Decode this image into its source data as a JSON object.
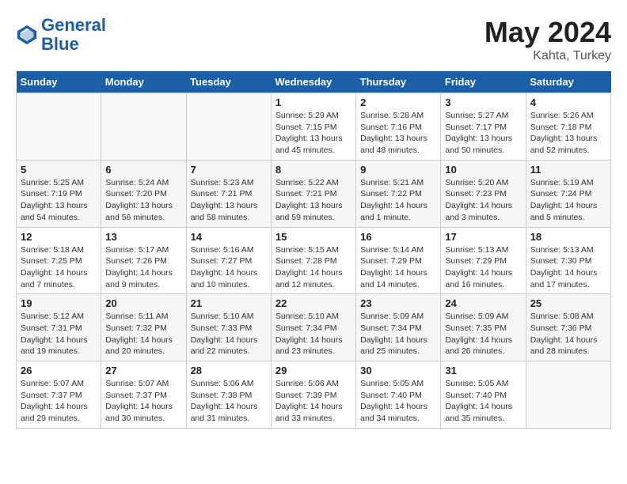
{
  "header": {
    "logo_line1": "General",
    "logo_line2": "Blue",
    "month": "May 2024",
    "location": "Kahta, Turkey"
  },
  "days_of_week": [
    "Sunday",
    "Monday",
    "Tuesday",
    "Wednesday",
    "Thursday",
    "Friday",
    "Saturday"
  ],
  "weeks": [
    [
      {
        "num": "",
        "info": ""
      },
      {
        "num": "",
        "info": ""
      },
      {
        "num": "",
        "info": ""
      },
      {
        "num": "1",
        "info": "Sunrise: 5:29 AM\nSunset: 7:15 PM\nDaylight: 13 hours\nand 45 minutes."
      },
      {
        "num": "2",
        "info": "Sunrise: 5:28 AM\nSunset: 7:16 PM\nDaylight: 13 hours\nand 48 minutes."
      },
      {
        "num": "3",
        "info": "Sunrise: 5:27 AM\nSunset: 7:17 PM\nDaylight: 13 hours\nand 50 minutes."
      },
      {
        "num": "4",
        "info": "Sunrise: 5:26 AM\nSunset: 7:18 PM\nDaylight: 13 hours\nand 52 minutes."
      }
    ],
    [
      {
        "num": "5",
        "info": "Sunrise: 5:25 AM\nSunset: 7:19 PM\nDaylight: 13 hours\nand 54 minutes."
      },
      {
        "num": "6",
        "info": "Sunrise: 5:24 AM\nSunset: 7:20 PM\nDaylight: 13 hours\nand 56 minutes."
      },
      {
        "num": "7",
        "info": "Sunrise: 5:23 AM\nSunset: 7:21 PM\nDaylight: 13 hours\nand 58 minutes."
      },
      {
        "num": "8",
        "info": "Sunrise: 5:22 AM\nSunset: 7:21 PM\nDaylight: 13 hours\nand 59 minutes."
      },
      {
        "num": "9",
        "info": "Sunrise: 5:21 AM\nSunset: 7:22 PM\nDaylight: 14 hours\nand 1 minute."
      },
      {
        "num": "10",
        "info": "Sunrise: 5:20 AM\nSunset: 7:23 PM\nDaylight: 14 hours\nand 3 minutes."
      },
      {
        "num": "11",
        "info": "Sunrise: 5:19 AM\nSunset: 7:24 PM\nDaylight: 14 hours\nand 5 minutes."
      }
    ],
    [
      {
        "num": "12",
        "info": "Sunrise: 5:18 AM\nSunset: 7:25 PM\nDaylight: 14 hours\nand 7 minutes."
      },
      {
        "num": "13",
        "info": "Sunrise: 5:17 AM\nSunset: 7:26 PM\nDaylight: 14 hours\nand 9 minutes."
      },
      {
        "num": "14",
        "info": "Sunrise: 5:16 AM\nSunset: 7:27 PM\nDaylight: 14 hours\nand 10 minutes."
      },
      {
        "num": "15",
        "info": "Sunrise: 5:15 AM\nSunset: 7:28 PM\nDaylight: 14 hours\nand 12 minutes."
      },
      {
        "num": "16",
        "info": "Sunrise: 5:14 AM\nSunset: 7:29 PM\nDaylight: 14 hours\nand 14 minutes."
      },
      {
        "num": "17",
        "info": "Sunrise: 5:13 AM\nSunset: 7:29 PM\nDaylight: 14 hours\nand 16 minutes."
      },
      {
        "num": "18",
        "info": "Sunrise: 5:13 AM\nSunset: 7:30 PM\nDaylight: 14 hours\nand 17 minutes."
      }
    ],
    [
      {
        "num": "19",
        "info": "Sunrise: 5:12 AM\nSunset: 7:31 PM\nDaylight: 14 hours\nand 19 minutes."
      },
      {
        "num": "20",
        "info": "Sunrise: 5:11 AM\nSunset: 7:32 PM\nDaylight: 14 hours\nand 20 minutes."
      },
      {
        "num": "21",
        "info": "Sunrise: 5:10 AM\nSunset: 7:33 PM\nDaylight: 14 hours\nand 22 minutes."
      },
      {
        "num": "22",
        "info": "Sunrise: 5:10 AM\nSunset: 7:34 PM\nDaylight: 14 hours\nand 23 minutes."
      },
      {
        "num": "23",
        "info": "Sunrise: 5:09 AM\nSunset: 7:34 PM\nDaylight: 14 hours\nand 25 minutes."
      },
      {
        "num": "24",
        "info": "Sunrise: 5:09 AM\nSunset: 7:35 PM\nDaylight: 14 hours\nand 26 minutes."
      },
      {
        "num": "25",
        "info": "Sunrise: 5:08 AM\nSunset: 7:36 PM\nDaylight: 14 hours\nand 28 minutes."
      }
    ],
    [
      {
        "num": "26",
        "info": "Sunrise: 5:07 AM\nSunset: 7:37 PM\nDaylight: 14 hours\nand 29 minutes."
      },
      {
        "num": "27",
        "info": "Sunrise: 5:07 AM\nSunset: 7:37 PM\nDaylight: 14 hours\nand 30 minutes."
      },
      {
        "num": "28",
        "info": "Sunrise: 5:06 AM\nSunset: 7:38 PM\nDaylight: 14 hours\nand 31 minutes."
      },
      {
        "num": "29",
        "info": "Sunrise: 5:06 AM\nSunset: 7:39 PM\nDaylight: 14 hours\nand 33 minutes."
      },
      {
        "num": "30",
        "info": "Sunrise: 5:05 AM\nSunset: 7:40 PM\nDaylight: 14 hours\nand 34 minutes."
      },
      {
        "num": "31",
        "info": "Sunrise: 5:05 AM\nSunset: 7:40 PM\nDaylight: 14 hours\nand 35 minutes."
      },
      {
        "num": "",
        "info": ""
      }
    ]
  ]
}
